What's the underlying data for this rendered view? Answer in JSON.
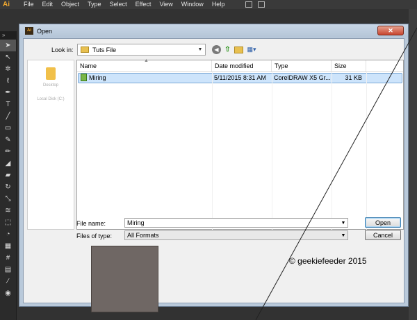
{
  "app": {
    "logo": "Ai",
    "menu": [
      "File",
      "Edit",
      "Object",
      "Type",
      "Select",
      "Effect",
      "View",
      "Window",
      "Help"
    ]
  },
  "tools": {
    "icons": [
      "selection-tool",
      "direct-selection-tool",
      "magic-wand-tool",
      "lasso-tool",
      "pen-tool",
      "type-tool",
      "line-tool",
      "rectangle-tool",
      "paintbrush-tool",
      "pencil-tool",
      "blob-brush-tool",
      "eraser-tool",
      "rotate-tool",
      "scale-tool",
      "width-tool",
      "free-transform-tool",
      "shape-builder-tool",
      "perspective-tool",
      "mesh-tool",
      "gradient-tool",
      "eyedropper-tool",
      "blend-tool"
    ]
  },
  "dialog": {
    "title": "Open",
    "close_label": "✕",
    "look_in_label": "Look in:",
    "look_in_value": "Tuts File",
    "places": [
      "Desktop",
      "Local Disk (C:)"
    ],
    "columns": [
      "Name",
      "Date modified",
      "Type",
      "Size"
    ],
    "files": [
      {
        "name": "Miring",
        "date": "5/11/2015 8:31 AM",
        "type": "CorelDRAW X5 Gr...",
        "size": "31 KB"
      }
    ],
    "file_name_label": "File name:",
    "file_name_value": "Miring",
    "files_of_type_label": "Files of type:",
    "files_of_type_value": "All Formats",
    "open_label": "Open",
    "cancel_label": "Cancel"
  },
  "watermark": "© geekiefeeder 2015"
}
